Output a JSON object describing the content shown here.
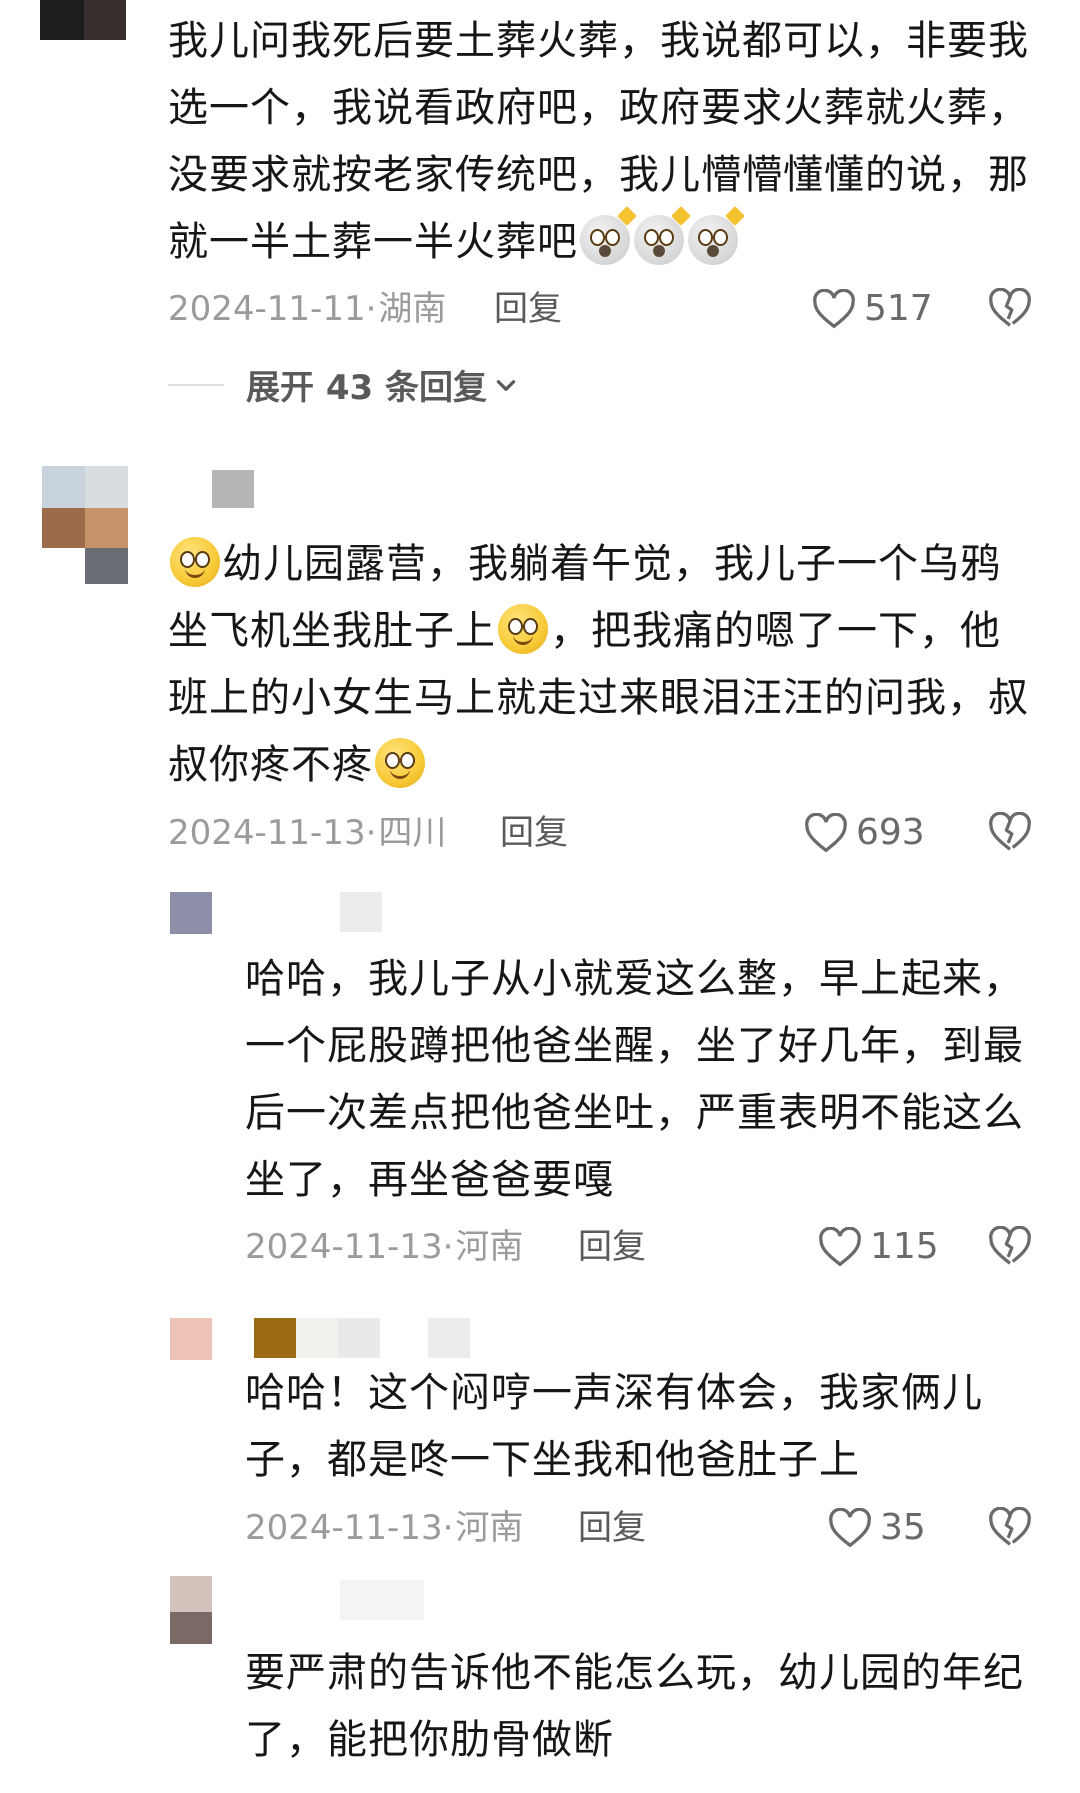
{
  "comments": [
    {
      "text_parts": [
        "我儿问我死后要土葬火葬，我说都可以，非要我选一个，我说看政府吧，政府要求火葬就火葬，没要求就按老家传统吧，我儿懵懵懂懂的说，那就一半土葬一半火葬吧"
      ],
      "emojis": [
        "shocked-face",
        "shocked-face",
        "shocked-face"
      ],
      "date": "2024-11-11",
      "location": "湖南",
      "reply_label": "回复",
      "likes": "517",
      "expand_label": "展开 43 条回复"
    },
    {
      "text_a": "幼儿园露营，我躺着午觉，我儿子一个乌鸦坐飞机坐我肚子上",
      "text_b": "，把我痛的嗯了一下，他班上的小女生马上就走过来眼泪汪汪的问我，叔叔你疼不疼",
      "date": "2024-11-13",
      "location": "四川",
      "reply_label": "回复",
      "likes": "693"
    },
    {
      "text": "哈哈，我儿子从小就爱这么整，早上起来，一个屁股蹲把他爸坐醒，坐了好几年，到最后一次差点把他爸坐吐，严重表明不能这么坐了，再坐爸爸要嘎",
      "date": "2024-11-13",
      "location": "河南",
      "reply_label": "回复",
      "likes": "115"
    },
    {
      "text": "哈哈！这个闷哼一声深有体会，我家俩儿子，都是咚一下坐我和他爸肚子上",
      "date": "2024-11-13",
      "location": "河南",
      "reply_label": "回复",
      "likes": "35"
    },
    {
      "text": "要严肃的告诉他不能怎么玩，幼儿园的年纪了，能把你肋骨做断"
    }
  ],
  "colors": {
    "meta": "#9b9b9b",
    "text": "#161616",
    "icon": "#6a6a6a"
  },
  "icons": [
    "heart-icon",
    "broken-heart-icon",
    "chevron-down-icon"
  ]
}
